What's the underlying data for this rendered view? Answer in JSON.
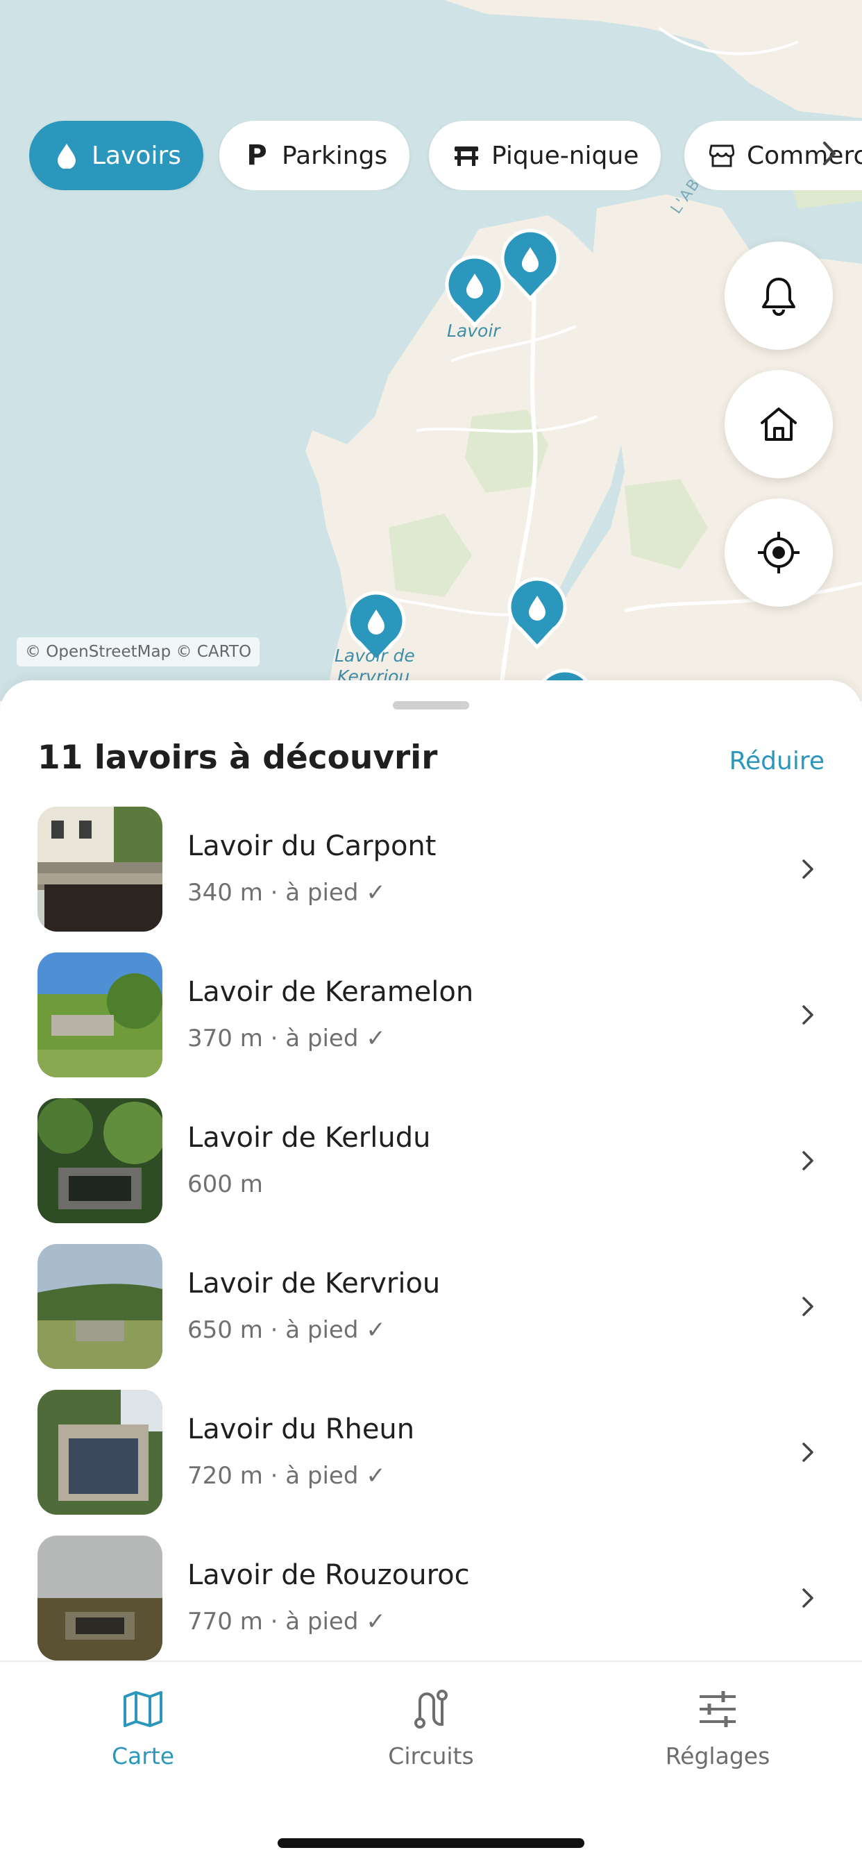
{
  "colors": {
    "accent": "#2b97bd",
    "water": "#cfe3e6",
    "land": "#f4efe6",
    "text": "#1f1f1f",
    "muted": "#707070"
  },
  "map": {
    "attribution": "© OpenStreetMap © CARTO",
    "labels": {
      "lavoir": "Lavoir",
      "kervriou_1": "Lavoir de",
      "kervriou_2": "Kervriou",
      "water": "L'AB"
    }
  },
  "filters": [
    {
      "label": "Lavoirs",
      "icon": "water-drop-icon",
      "active": true
    },
    {
      "label": "Parkings",
      "icon": "parking-icon",
      "active": false
    },
    {
      "label": "Pique-nique",
      "icon": "picnic-table-icon",
      "active": false
    },
    {
      "label": "Commerces",
      "icon": "store-icon",
      "active": false
    }
  ],
  "fabs": [
    {
      "icon": "bell-icon"
    },
    {
      "icon": "home-icon"
    },
    {
      "icon": "locate-icon"
    }
  ],
  "sheet": {
    "title": "11 lavoirs à découvrir",
    "collapse_label": "Réduire",
    "items": [
      {
        "title": "Lavoir du Carpont",
        "subtitle": "340 m · à pied ✓"
      },
      {
        "title": "Lavoir de Keramelon",
        "subtitle": "370 m · à pied ✓"
      },
      {
        "title": "Lavoir de Kerludu",
        "subtitle": "600 m"
      },
      {
        "title": "Lavoir de Kervriou",
        "subtitle": "650 m · à pied ✓"
      },
      {
        "title": "Lavoir du Rheun",
        "subtitle": "720 m · à pied ✓"
      },
      {
        "title": "Lavoir de Rouzouroc",
        "subtitle": "770 m · à pied ✓"
      }
    ]
  },
  "tabs": [
    {
      "label": "Carte",
      "icon": "map-icon",
      "active": true
    },
    {
      "label": "Circuits",
      "icon": "route-icon",
      "active": false
    },
    {
      "label": "Réglages",
      "icon": "sliders-icon",
      "active": false
    }
  ]
}
